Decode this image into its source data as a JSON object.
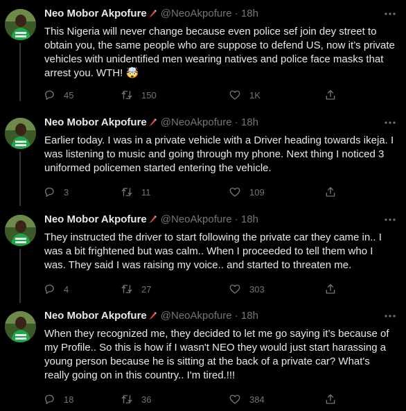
{
  "author": {
    "name": "Neo Mobor Akpofure",
    "badge_icon": "paintbrush-emoji",
    "handle": "@NeoAkpofure",
    "separator": "·"
  },
  "colors": {
    "background": "#000000",
    "text": "#e7e9ea",
    "secondary": "#71767b",
    "thread_line": "#333639"
  },
  "tweets": [
    {
      "time": "18h",
      "text": "This Nigeria will never change because even police sef join dey street to obtain you, the same people who are suppose to defend US, now it’s private vehicles with unidentified men wearing natives and police face masks that arrest you. WTH! 🤯",
      "replies": "45",
      "retweets": "150",
      "likes": "1K"
    },
    {
      "time": "18h",
      "text": "Earlier today. I was in a private vehicle with a Driver heading towards ikeja. I was listening to music and going through my phone. Next thing I noticed 3 uniformed policemen started entering the vehicle.",
      "replies": "3",
      "retweets": "11",
      "likes": "109"
    },
    {
      "time": "18h",
      "text": "They instructed the driver to start following the private car they came in.. I was a bit frightened but was calm.. When I proceeded to tell them who I was. They said I was raising my voice.. and started to threaten me.",
      "replies": "4",
      "retweets": "27",
      "likes": "303"
    },
    {
      "time": "18h",
      "text": "When they recognized me, they decided to let me go saying it’s because of my Profile.. So this is how if I wasn't NEO they would just start harassing a young person because he is sitting at the back of a private car? What's really going on in this country.. I'm tired.!!!",
      "replies": "18",
      "retweets": "36",
      "likes": "384"
    }
  ]
}
